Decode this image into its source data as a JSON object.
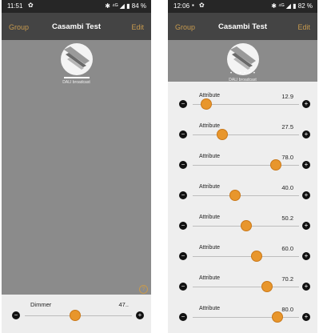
{
  "panel1": {
    "status": {
      "time": "11:51",
      "right": "✱ ⁴ᴳ ◢ ▮ 84 %"
    },
    "nav": {
      "left": "Group",
      "title": "Casambi Test",
      "right": "Edit"
    },
    "luminaire": {
      "label": "DALI broadcast"
    },
    "help_icon": "?",
    "dimmer": {
      "label": "Dimmer",
      "value": "47..",
      "level": 0.47
    },
    "icons": {
      "minus": "minus-icon",
      "plus": "plus-icon",
      "help": "help-icon"
    }
  },
  "panel2": {
    "status": {
      "time": "12:06",
      "right": "✱ ⁴ᴳ ◢ ▮ 82 %"
    },
    "nav": {
      "left": "Group",
      "title": "Casambi Test",
      "right": "Edit"
    },
    "luminaire": {
      "label": "DALI broadcast",
      "dots": "• • • • • •"
    },
    "attributes": [
      {
        "label": "Attribute",
        "value": "12.9",
        "level": 0.129
      },
      {
        "label": "Attribute",
        "value": "27.5",
        "level": 0.275
      },
      {
        "label": "Attribute",
        "value": "78.0",
        "level": 0.78
      },
      {
        "label": "Attribute",
        "value": "40.0",
        "level": 0.4
      },
      {
        "label": "Attribute",
        "value": "50.2",
        "level": 0.502
      },
      {
        "label": "Attribute",
        "value": "60.0",
        "level": 0.6
      },
      {
        "label": "Attribute",
        "value": "70.2",
        "level": 0.702
      },
      {
        "label": "Attribute",
        "value": "80.0",
        "level": 0.8
      }
    ]
  },
  "colors": {
    "accent": "#e8962c",
    "nav_link": "#c79a4e",
    "background": "#8b8b8b",
    "navbar": "#444444"
  }
}
